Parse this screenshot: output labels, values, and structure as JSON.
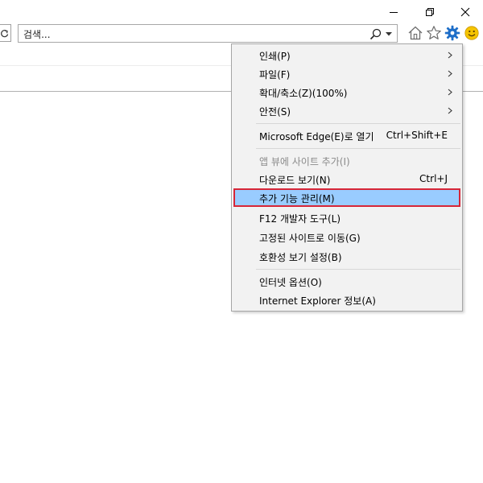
{
  "window_controls": {
    "minimize_icon": "minimize-icon",
    "restore_icon": "restore-icon",
    "close_icon": "close-icon"
  },
  "address_bar": {
    "refresh_icon": "refresh-icon"
  },
  "search": {
    "placeholder": "검색...",
    "icon": "search-icon",
    "dropdown_icon": "chevron-down-icon"
  },
  "toolbar": {
    "home_icon": "home-icon",
    "favorites_icon": "star-icon",
    "tools_icon": "gear-icon",
    "feedback_icon": "smiley-icon",
    "accent_color": "#1e6ec8",
    "feedback_color": "#f5c400"
  },
  "tools_menu": {
    "highlight_color": "#99ccff",
    "highlight_border_color": "#d72638",
    "items": [
      {
        "label": "인쇄(P)",
        "submenu": true
      },
      {
        "label": "파일(F)",
        "submenu": true
      },
      {
        "label": "확대/축소(Z)(100%)",
        "submenu": true
      },
      {
        "label": "안전(S)",
        "submenu": true
      },
      {
        "label": "Microsoft Edge(E)로 열기",
        "shortcut": "Ctrl+Shift+E"
      },
      {
        "label": "앱 뷰에 사이트 추가(I)",
        "disabled": true
      },
      {
        "label": "다운로드 보기(N)",
        "shortcut": "Ctrl+J"
      },
      {
        "label": "추가 기능 관리(M)",
        "highlighted": true
      },
      {
        "label": "F12 개발자 도구(L)"
      },
      {
        "label": "고정된 사이트로 이동(G)"
      },
      {
        "label": "호환성 보기 설정(B)"
      },
      {
        "label": "인터넷 옵션(O)"
      },
      {
        "label": "Internet Explorer 정보(A)"
      }
    ]
  }
}
